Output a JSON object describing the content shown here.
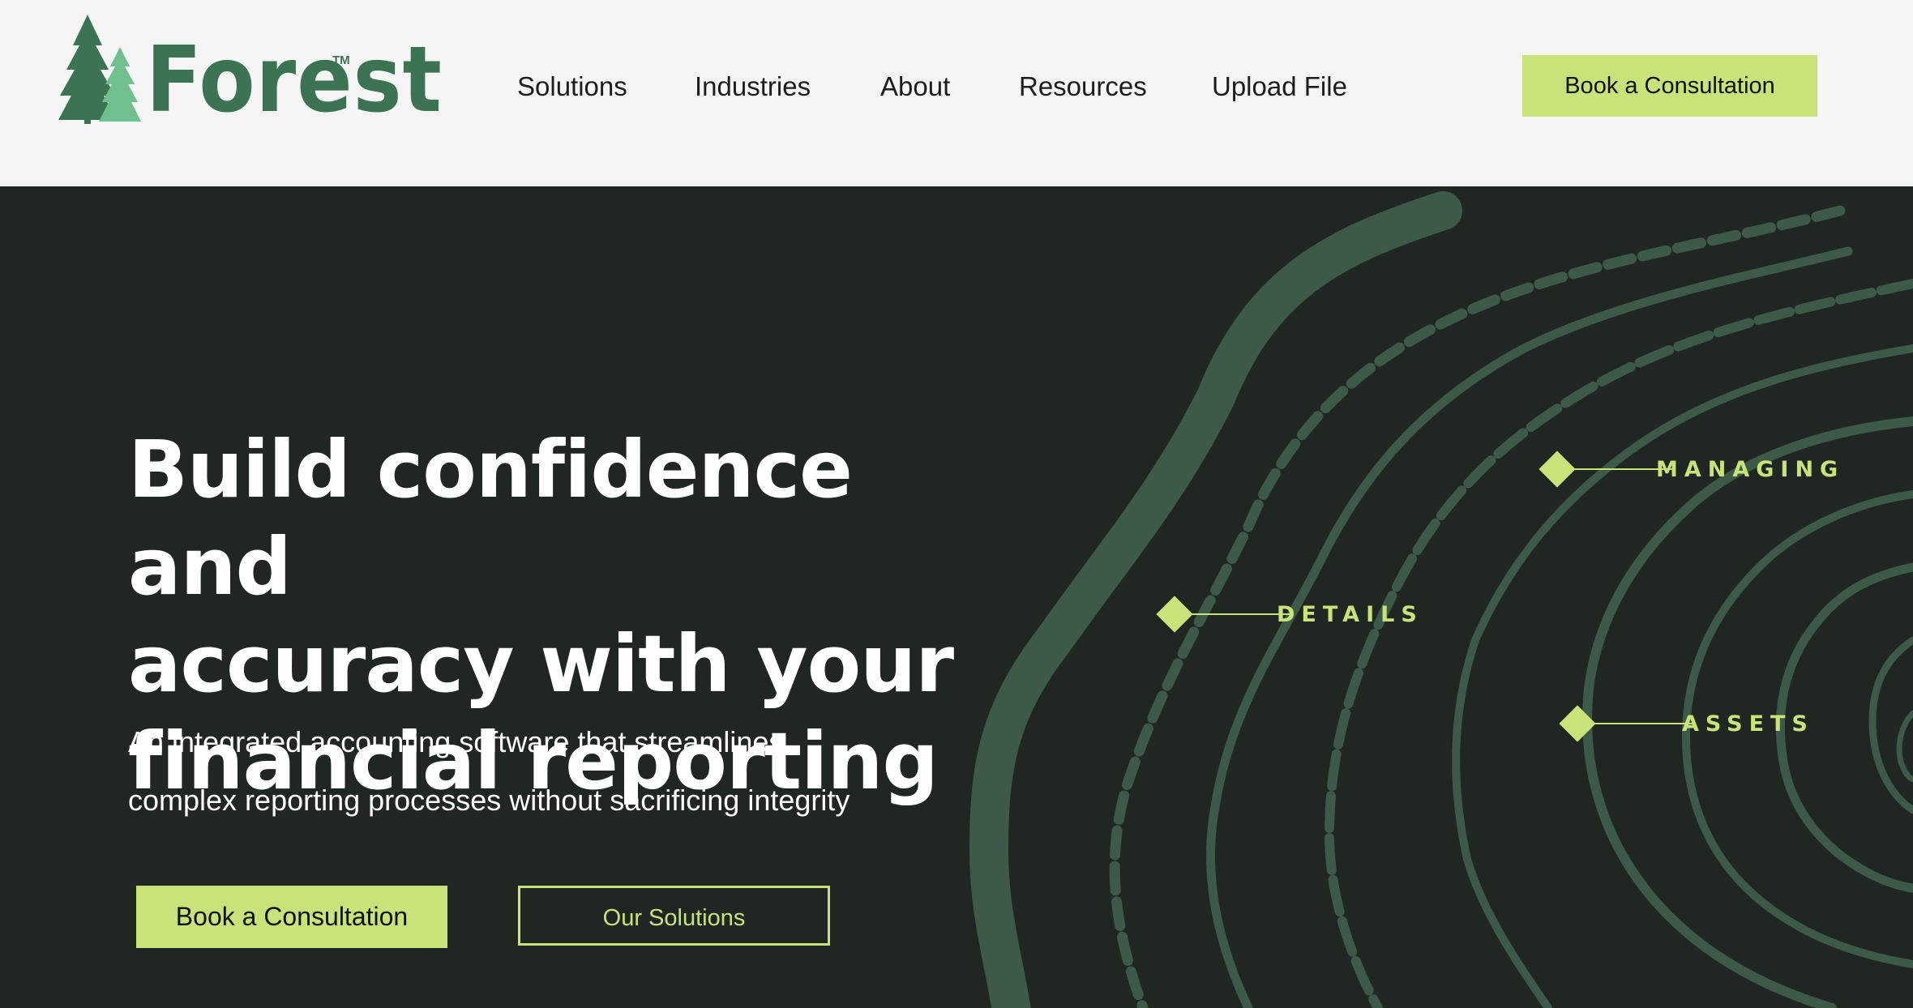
{
  "brand": {
    "name": "Forest",
    "tm": "TM"
  },
  "nav": {
    "items": [
      {
        "label": "Solutions"
      },
      {
        "label": "Industries"
      },
      {
        "label": "About"
      },
      {
        "label": "Resources"
      },
      {
        "label": "Upload File"
      }
    ],
    "cta_label": "Book a Consultation"
  },
  "hero": {
    "headline_line1": "Build confidence and",
    "headline_line2": "accuracy with your",
    "headline_line3": "financial reporting",
    "subtitle_line1": "An integrated accounting software that streamlines",
    "subtitle_line2": "complex reporting processes without sacrificing integrity",
    "primary_button": "Book a Consultation",
    "secondary_button": "Our Solutions",
    "markers": [
      {
        "label": "MANAGING"
      },
      {
        "label": "DETAILS"
      },
      {
        "label": "ASSETS"
      }
    ]
  },
  "colors": {
    "accent": "#c9e37b",
    "hero_bg": "#202622",
    "rings": "#3d5a48",
    "brand_green": "#3b7353",
    "brand_light_green": "#6fbf8f",
    "nav_bg": "#f4f5f4"
  },
  "icons": {
    "logo": "pine-trees-icon"
  }
}
